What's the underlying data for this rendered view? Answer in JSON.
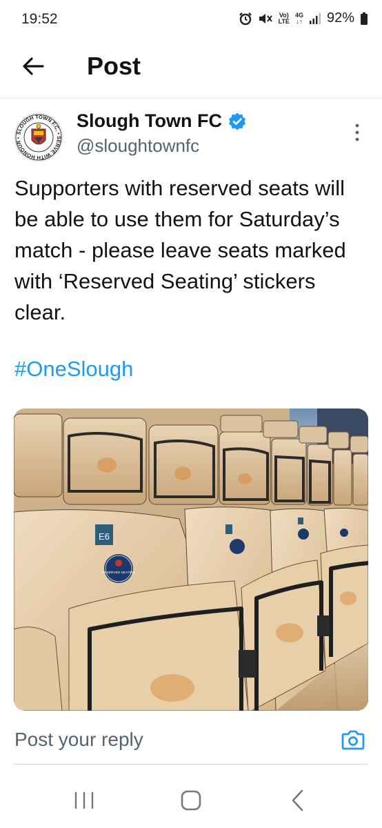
{
  "status_bar": {
    "time": "19:52",
    "network_top": "Vo)",
    "network_bottom": "LTE",
    "gen_top": "4G",
    "gen_bottom": "↓↑",
    "battery": "92%"
  },
  "header": {
    "title": "Post"
  },
  "post": {
    "author_name": "Slough Town FC",
    "handle": "@sloughtownfc",
    "text": "Supporters with reserved seats will be able to use them for Saturday’s match - please leave seats marked with ‘Reserved Seating’ stickers clear.",
    "hashtag": "#OneSlough",
    "avatar_ring_text": "SLOUGH TOWN F.C. • SERVE WITH HONOUR",
    "image": {
      "seat_tag": "E6",
      "sticker_text": "RESERVED SEATING"
    }
  },
  "reply": {
    "placeholder": "Post your reply"
  },
  "colors": {
    "accent": "#1d9bf0",
    "text": "#0f1419",
    "secondary": "#536471"
  },
  "icons": {
    "back": "arrow-left-icon",
    "verified": "verified-badge-icon",
    "more": "more-vertical-icon",
    "camera": "camera-icon",
    "nav_recents": "recents-icon",
    "nav_home": "home-icon",
    "nav_back": "chevron-left-icon"
  }
}
